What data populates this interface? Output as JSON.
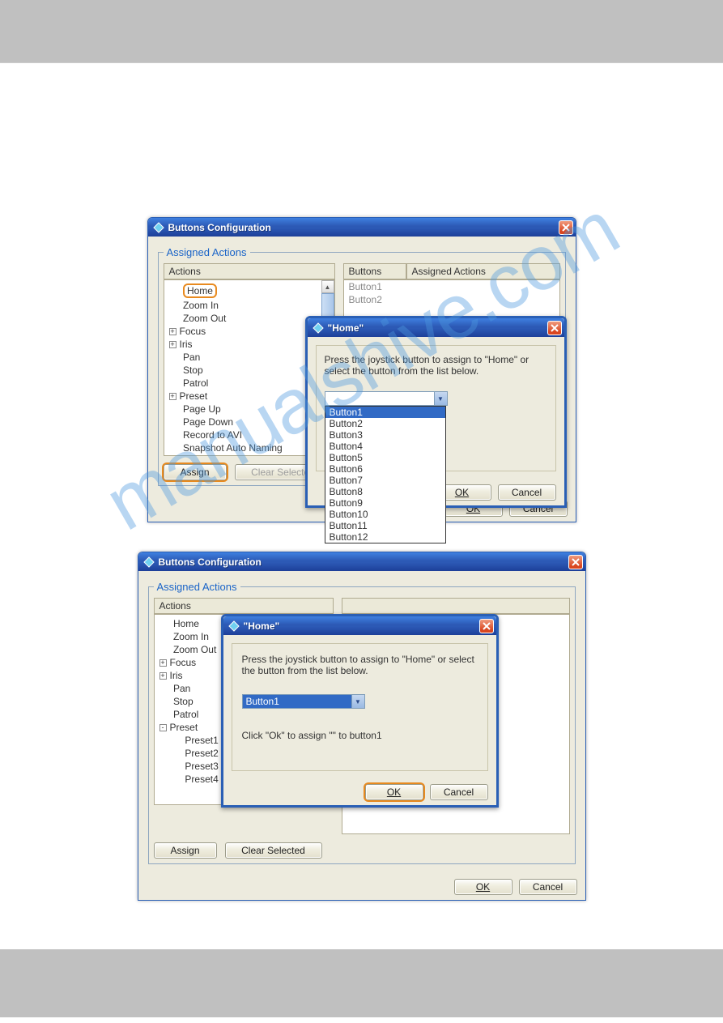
{
  "watermark_text": "manualshive.com",
  "window1": {
    "title": "Buttons Configuration",
    "legend": "Assigned Actions",
    "col_actions": "Actions",
    "col_buttons": "Buttons",
    "col_assigned": "Assigned Actions",
    "tree": {
      "home": "Home",
      "zoom_in": "Zoom In",
      "zoom_out": "Zoom Out",
      "focus": "Focus",
      "iris": "Iris",
      "pan": "Pan",
      "stop": "Stop",
      "patrol": "Patrol",
      "preset": "Preset",
      "page_up": "Page Up",
      "page_down": "Page Down",
      "record_avi": "Record to AVI",
      "snapshot": "Snapshot Auto Naming"
    },
    "buttons_rows": {
      "b1": "Button1",
      "b2": "Button2"
    },
    "btn_assign": "Assign",
    "btn_clear": "Clear Selected",
    "btn_ok": "OK",
    "btn_cancel": "Cancel"
  },
  "modal_home1": {
    "title": "\"Home\"",
    "instruction": "Press the joystick button to assign to \"Home\" or select the button from the list below.",
    "selected": "",
    "options": {
      "b1": "Button1",
      "b2": "Button2",
      "b3": "Button3",
      "b4": "Button4",
      "b5": "Button5",
      "b6": "Button6",
      "b7": "Button7",
      "b8": "Button8",
      "b9": "Button9",
      "b10": "Button10",
      "b11": "Button11",
      "b12": "Button12"
    },
    "btn_ok": "OK",
    "btn_cancel": "Cancel"
  },
  "window2": {
    "title": "Buttons Configuration",
    "legend": "Assigned Actions",
    "col_actions": "Actions",
    "tree": {
      "home": "Home",
      "zoom_in": "Zoom In",
      "zoom_out": "Zoom Out",
      "focus": "Focus",
      "iris": "Iris",
      "pan": "Pan",
      "stop": "Stop",
      "patrol": "Patrol",
      "preset": "Preset",
      "preset1": "Preset1",
      "preset2": "Preset2",
      "preset3": "Preset3",
      "preset4": "Preset4"
    },
    "btn_assign": "Assign",
    "btn_clear": "Clear Selected",
    "btn_ok": "OK",
    "btn_cancel": "Cancel"
  },
  "modal_home2": {
    "title": "\"Home\"",
    "instruction": "Press the joystick button to assign to \"Home\" or select the button from the list below.",
    "selected": "Button1",
    "confirm_text": "Click \"Ok\" to assign \"\" to button1",
    "btn_ok": "OK",
    "btn_cancel": "Cancel"
  }
}
